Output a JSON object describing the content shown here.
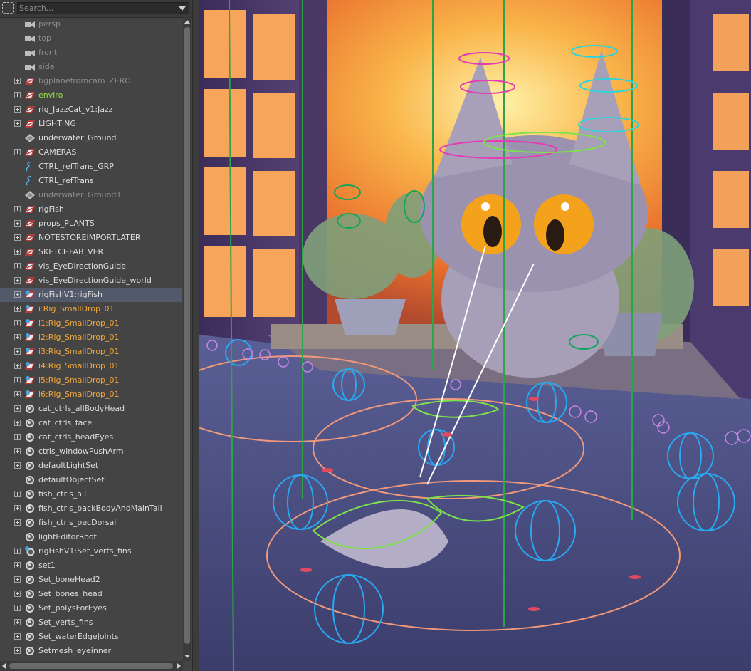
{
  "search": {
    "placeholder": "Search..."
  },
  "outliner": {
    "items": [
      {
        "label": "persp",
        "icon": "camera-icon",
        "state": "dim",
        "expandable": false
      },
      {
        "label": "top",
        "icon": "camera-icon",
        "state": "dim",
        "expandable": false
      },
      {
        "label": "front",
        "icon": "camera-icon",
        "state": "dim",
        "expandable": false
      },
      {
        "label": "side",
        "icon": "camera-icon",
        "state": "dim",
        "expandable": false
      },
      {
        "label": "bgplanefromcam_ZERO",
        "icon": "group-icon",
        "state": "dim",
        "expandable": true
      },
      {
        "label": "enviro",
        "icon": "group-icon",
        "state": "green",
        "expandable": true
      },
      {
        "label": "rig_JazzCat_v1:Jazz",
        "icon": "group-icon",
        "state": "normal",
        "expandable": true
      },
      {
        "label": "LIGHTING",
        "icon": "group-icon",
        "state": "normal",
        "expandable": true
      },
      {
        "label": "underwater_Ground",
        "icon": "mesh-icon",
        "state": "normal",
        "expandable": false
      },
      {
        "label": "CAMERAS",
        "icon": "group-icon",
        "state": "normal",
        "expandable": true
      },
      {
        "label": "CTRL_refTrans_GRP",
        "icon": "curve-icon",
        "state": "normal",
        "expandable": false
      },
      {
        "label": "CTRL_refTrans",
        "icon": "curve-icon",
        "state": "normal",
        "expandable": false
      },
      {
        "label": "underwater_Ground1",
        "icon": "mesh-icon",
        "state": "dim",
        "expandable": false
      },
      {
        "label": "rigFish",
        "icon": "group-icon",
        "state": "normal",
        "expandable": true
      },
      {
        "label": "props_PLANTS",
        "icon": "group-icon",
        "state": "normal",
        "expandable": true
      },
      {
        "label": "NOTESTOREIMPORTLATER",
        "icon": "group-icon",
        "state": "normal",
        "expandable": true
      },
      {
        "label": "SKETCHFAB_VER",
        "icon": "group-icon",
        "state": "normal",
        "expandable": true
      },
      {
        "label": "vis_EyeDirectionGuide",
        "icon": "group-icon",
        "state": "normal",
        "expandable": true
      },
      {
        "label": "vis_EyeDirectionGuide_world",
        "icon": "group-icon",
        "state": "normal",
        "expandable": true
      },
      {
        "label": "rigFishV1:rigFish",
        "icon": "reference-group-icon",
        "state": "normal",
        "expandable": true,
        "selected": true
      },
      {
        "label": "i:Rig_SmallDrop_01",
        "icon": "reference-group-icon",
        "state": "orange",
        "expandable": true
      },
      {
        "label": "i1:Rig_SmallDrop_01",
        "icon": "reference-group-icon",
        "state": "orange",
        "expandable": true
      },
      {
        "label": "i2:Rig_SmallDrop_01",
        "icon": "reference-group-icon",
        "state": "orange",
        "expandable": true
      },
      {
        "label": "i3:Rig_SmallDrop_01",
        "icon": "reference-group-icon",
        "state": "orange",
        "expandable": true
      },
      {
        "label": "i4:Rig_SmallDrop_01",
        "icon": "reference-group-icon",
        "state": "orange",
        "expandable": true
      },
      {
        "label": "i5:Rig_SmallDrop_01",
        "icon": "reference-group-icon",
        "state": "orange",
        "expandable": true
      },
      {
        "label": "i6:Rig_SmallDrop_01",
        "icon": "reference-group-icon",
        "state": "orange",
        "expandable": true
      },
      {
        "label": "cat_ctrls_allBodyHead",
        "icon": "set-icon",
        "state": "normal",
        "expandable": true
      },
      {
        "label": "cat_ctrls_face",
        "icon": "set-icon",
        "state": "normal",
        "expandable": true
      },
      {
        "label": "cat_ctrls_headEyes",
        "icon": "set-icon",
        "state": "normal",
        "expandable": true
      },
      {
        "label": "ctrls_windowPushArm",
        "icon": "set-icon",
        "state": "normal",
        "expandable": true
      },
      {
        "label": "defaultLightSet",
        "icon": "set-icon",
        "state": "normal",
        "expandable": true
      },
      {
        "label": "defaultObjectSet",
        "icon": "set-icon",
        "state": "normal",
        "expandable": false
      },
      {
        "label": "fish_ctrls_all",
        "icon": "set-icon",
        "state": "normal",
        "expandable": true
      },
      {
        "label": "fish_ctrls_backBodyAndMainTail",
        "icon": "set-icon",
        "state": "normal",
        "expandable": true
      },
      {
        "label": "fish_ctrls_pecDorsal",
        "icon": "set-icon",
        "state": "normal",
        "expandable": true
      },
      {
        "label": "lightEditorRoot",
        "icon": "set-icon",
        "state": "normal",
        "expandable": false
      },
      {
        "label": "rigFishV1:Set_verts_fins",
        "icon": "reference-set-icon",
        "state": "normal",
        "expandable": true
      },
      {
        "label": "set1",
        "icon": "set-icon",
        "state": "normal",
        "expandable": true
      },
      {
        "label": "Set_boneHead2",
        "icon": "set-icon",
        "state": "normal",
        "expandable": true
      },
      {
        "label": "Set_bones_head",
        "icon": "set-icon",
        "state": "normal",
        "expandable": true
      },
      {
        "label": "Set_polysForEyes",
        "icon": "set-icon",
        "state": "normal",
        "expandable": true
      },
      {
        "label": "Set_verts_fins",
        "icon": "set-icon",
        "state": "normal",
        "expandable": true
      },
      {
        "label": "Set_waterEdgeJoints",
        "icon": "set-icon",
        "state": "normal",
        "expandable": true
      },
      {
        "label": "Setmesh_eyeinner",
        "icon": "set-icon",
        "state": "normal",
        "expandable": true
      }
    ]
  },
  "colors": {
    "panel": "#444444",
    "selected_row": "#52596a",
    "green_text": "#9ee04a",
    "orange_text": "#f1a63a",
    "dim_text": "#8c8c8c"
  }
}
